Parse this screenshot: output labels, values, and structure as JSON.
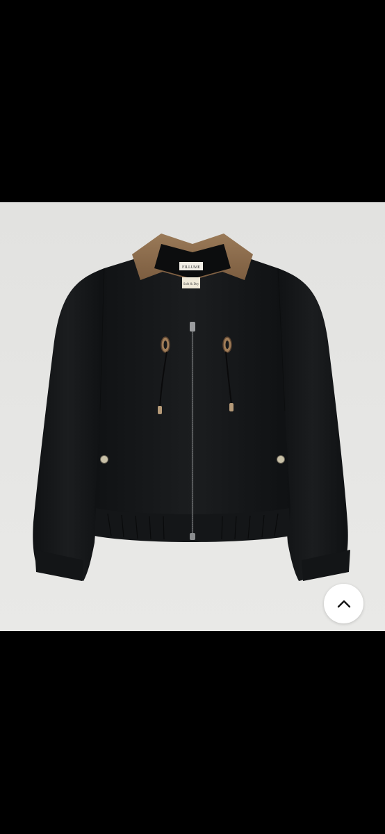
{
  "product_image": {
    "subject": "black-jacket-with-brown-corduroy-collar",
    "label_brand_text": "FILLUME",
    "label_secondary_text": "Soft & Dry"
  },
  "scroll_top_button": {
    "icon": "chevron-up-icon"
  },
  "colors": {
    "background_bars": "#000000",
    "photo_backdrop": "#e4e4e2",
    "jacket_body": "#16181a",
    "collar": "#8a6a4a",
    "button_bg": "#ffffff"
  }
}
